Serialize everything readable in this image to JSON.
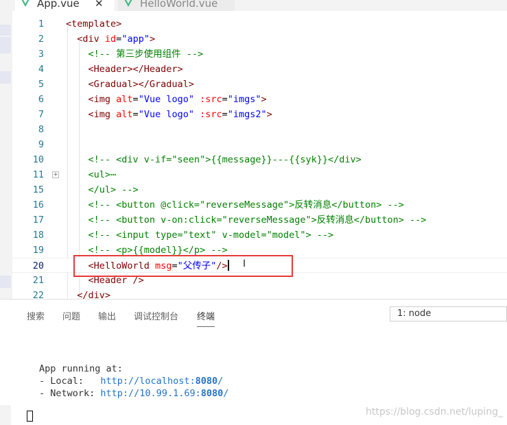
{
  "tabs": [
    {
      "label": "App.vue",
      "close": "✕"
    },
    {
      "label": "HelloWorld.vue"
    }
  ],
  "editor": {
    "lines": [
      {
        "num": "1",
        "tokens": [
          {
            "c": "t-tag",
            "t": "<template>"
          }
        ]
      },
      {
        "num": "2",
        "tokens": [
          {
            "c": "t-tag",
            "t": "  <div "
          },
          {
            "c": "t-attr",
            "t": "id"
          },
          {
            "c": "t-plain",
            "t": "="
          },
          {
            "c": "t-str",
            "t": "\"app\""
          },
          {
            "c": "t-tag",
            "t": ">"
          }
        ]
      },
      {
        "num": "3",
        "tokens": [
          {
            "c": "t-cmt",
            "t": "    <!-- 第三步使用组件 -->"
          }
        ]
      },
      {
        "num": "4",
        "tokens": [
          {
            "c": "t-tag",
            "t": "    <Header></Header>"
          }
        ]
      },
      {
        "num": "5",
        "tokens": [
          {
            "c": "t-tag",
            "t": "    <Gradual></Gradual>"
          }
        ]
      },
      {
        "num": "6",
        "tokens": [
          {
            "c": "t-tag",
            "t": "    <img "
          },
          {
            "c": "t-attr",
            "t": "alt"
          },
          {
            "c": "t-plain",
            "t": "="
          },
          {
            "c": "t-str",
            "t": "\"Vue logo\""
          },
          {
            "c": "t-plain",
            "t": " "
          },
          {
            "c": "t-attr",
            "t": ":src"
          },
          {
            "c": "t-plain",
            "t": "="
          },
          {
            "c": "t-str",
            "t": "\"imgs\""
          },
          {
            "c": "t-tag",
            "t": ">"
          }
        ]
      },
      {
        "num": "7",
        "tokens": [
          {
            "c": "t-tag",
            "t": "    <img "
          },
          {
            "c": "t-attr",
            "t": "alt"
          },
          {
            "c": "t-plain",
            "t": "="
          },
          {
            "c": "t-str",
            "t": "\"Vue logo\""
          },
          {
            "c": "t-plain",
            "t": " "
          },
          {
            "c": "t-attr",
            "t": ":src"
          },
          {
            "c": "t-plain",
            "t": "="
          },
          {
            "c": "t-str",
            "t": "\"imgs2\""
          },
          {
            "c": "t-tag",
            "t": ">"
          }
        ]
      },
      {
        "num": "8",
        "tokens": []
      },
      {
        "num": "9",
        "tokens": []
      },
      {
        "num": "10",
        "tokens": [
          {
            "c": "t-cmt",
            "t": "    <!-- <div v-if=\"seen\">{{message}}---{{syk}}</div>"
          }
        ]
      },
      {
        "num": "11",
        "tokens": [
          {
            "c": "t-cmt",
            "t": "    <ul>⋯"
          }
        ],
        "fold": "+"
      },
      {
        "num": "15",
        "tokens": [
          {
            "c": "t-cmt",
            "t": "    </ul> -->"
          }
        ]
      },
      {
        "num": "16",
        "tokens": [
          {
            "c": "t-cmt",
            "t": "    <!-- <button @click=\"reverseMessage\">反转消息</button> -->"
          }
        ]
      },
      {
        "num": "17",
        "tokens": [
          {
            "c": "t-cmt",
            "t": "    <!-- <button v-on:click=\"reverseMessage\">反转消息</button> -->"
          }
        ]
      },
      {
        "num": "18",
        "tokens": [
          {
            "c": "t-cmt",
            "t": "    <!-- <input type=\"text\" v-model=\"model\"> -->"
          }
        ]
      },
      {
        "num": "19",
        "tokens": [
          {
            "c": "t-cmt",
            "t": "    <!-- <p>{{model}}</p> -->"
          }
        ]
      },
      {
        "num": "20",
        "tokens": [
          {
            "c": "t-tag",
            "t": "    <HelloWorld "
          },
          {
            "c": "t-attr",
            "t": "msg"
          },
          {
            "c": "t-plain",
            "t": "="
          },
          {
            "c": "t-str",
            "t": "\"父传子\""
          },
          {
            "c": "t-tag",
            "t": "/>"
          }
        ],
        "current": true
      },
      {
        "num": "21",
        "tokens": [
          {
            "c": "t-tag",
            "t": "    <Header />"
          }
        ]
      },
      {
        "num": "22",
        "tokens": [
          {
            "c": "t-tag",
            "t": "  </div>"
          }
        ]
      }
    ]
  },
  "panel": {
    "tabs": [
      "搜索",
      "问题",
      "输出",
      "调试控制台",
      "终端"
    ],
    "active_tab": "终端",
    "terminal_select": "1: node",
    "terminal": {
      "line1": "App running at:",
      "local_label": "- Local:   ",
      "local_url": "http://localhost:",
      "local_port": "8080",
      "local_tail": "/",
      "network_label": "- Network: ",
      "network_url": "http://10.99.1.69:",
      "network_port": "8080",
      "network_tail": "/"
    }
  },
  "watermark": "https://blog.csdn.net/luping_",
  "colors": {
    "tag": "#800000",
    "attr": "#ff0000",
    "string": "#0000ff",
    "comment": "#008000",
    "highlight_box": "#e53935",
    "vue_green": "#41b883"
  }
}
